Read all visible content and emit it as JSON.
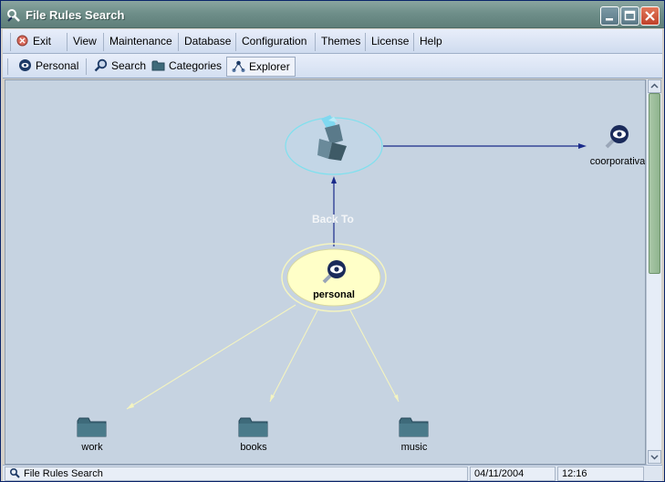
{
  "window": {
    "title": "File Rules Search"
  },
  "menu": {
    "exit": "Exit",
    "view": "View",
    "maintenance": "Maintenance",
    "database": "Database",
    "configuration": "Configuration",
    "themes": "Themes",
    "license": "License",
    "help": "Help"
  },
  "toolbar": {
    "personal": "Personal",
    "search": "Search",
    "categories": "Categories",
    "explorer": "Explorer",
    "active": "Explorer"
  },
  "graph": {
    "back_to": "Back To",
    "center_node": "personal",
    "linked_node": "coorporativa",
    "folders": [
      "work",
      "books",
      "music"
    ]
  },
  "status": {
    "app": "File Rules Search",
    "date": "04/11/2004",
    "time": "12:16"
  },
  "colors": {
    "title_bar": "#6f8f8a",
    "canvas_bg": "#c6d3e1",
    "center_node_fill": "#ffffc8",
    "edge_main": "#1a2a8a",
    "edge_child": "#f4f4c0",
    "folder": "#3e6a7a"
  },
  "icons": {
    "app": "app-logo-icon",
    "exit": "exit-icon",
    "personal": "eye-icon",
    "search": "search-icon",
    "categories": "folder-icon",
    "explorer": "explorer-network-icon",
    "node": "magnifier-eye-icon",
    "folder": "folder-icon"
  }
}
